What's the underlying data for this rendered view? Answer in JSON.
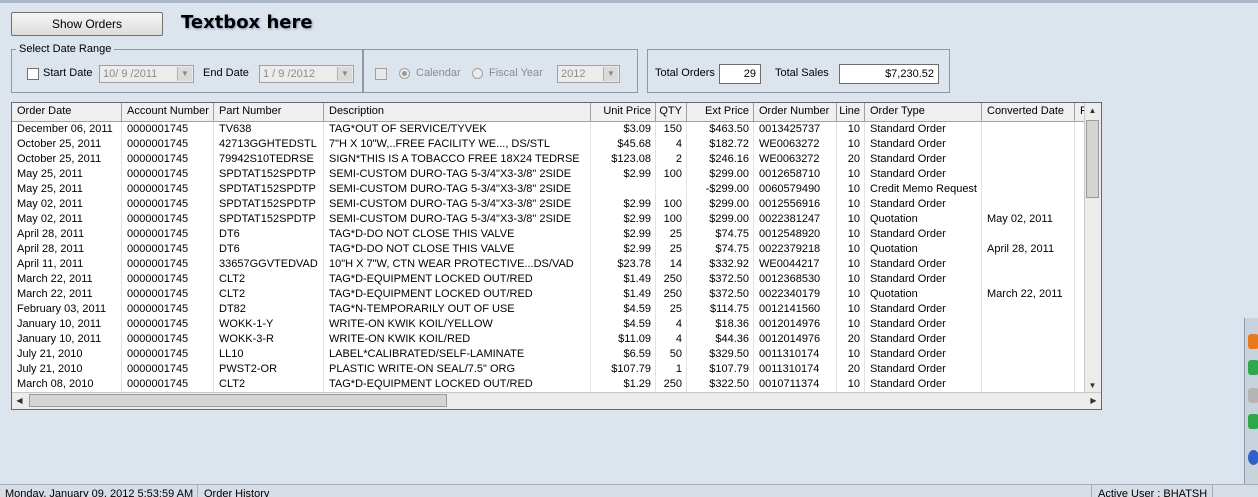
{
  "toolbar": {
    "show_orders_label": "Show Orders",
    "textbox_label": "Textbox here"
  },
  "date_range": {
    "legend": "Select Date Range",
    "start_date_label": "Start Date",
    "start_date_value": "10/ 9 /2011",
    "end_date_label": "End Date",
    "end_date_value": " 1 / 9 /2012",
    "calendar_label": "Calendar",
    "fiscal_year_label": "Fiscal Year",
    "year_value": "2012"
  },
  "totals": {
    "total_orders_label": "Total Orders",
    "total_orders_value": "29",
    "total_sales_label": "Total Sales",
    "total_sales_value": "$7,230.52"
  },
  "grid": {
    "columns": [
      "Order Date",
      "Account Number",
      "Part Number",
      "Description",
      "Unit Price",
      "QTY",
      "Ext Price",
      "Order Number",
      "Line",
      "Order Type",
      "Converted Date",
      "F"
    ],
    "rows": [
      [
        "December 06, 2011",
        "0000001745",
        "TV638",
        "TAG*OUT OF SERVICE/TYVEK",
        "$3.09",
        "150",
        "$463.50",
        "0013425737",
        "10",
        "Standard Order",
        ""
      ],
      [
        "October 25, 2011",
        "0000001745",
        "42713GGHTEDSTL",
        "7\"H X 10\"W,..FREE FACILITY WE..., DS/STL",
        "$45.68",
        "4",
        "$182.72",
        "WE0063272",
        "10",
        "Standard Order",
        ""
      ],
      [
        "October 25, 2011",
        "0000001745",
        "79942S10TEDRSE",
        "SIGN*THIS IS A TOBACCO FREE 18X24 TEDRSE",
        "$123.08",
        "2",
        "$246.16",
        "WE0063272",
        "20",
        "Standard Order",
        ""
      ],
      [
        "May 25, 2011",
        "0000001745",
        "SPDTAT152SPDTP",
        "SEMI-CUSTOM DURO-TAG 5-3/4\"X3-3/8\" 2SIDE",
        "$2.99",
        "100",
        "$299.00",
        "0012658710",
        "10",
        "Standard Order",
        ""
      ],
      [
        "May 25, 2011",
        "0000001745",
        "SPDTAT152SPDTP",
        "SEMI-CUSTOM DURO-TAG 5-3/4\"X3-3/8\" 2SIDE",
        "",
        "",
        "-$299.00",
        "0060579490",
        "10",
        "Credit Memo Request",
        ""
      ],
      [
        "May 02, 2011",
        "0000001745",
        "SPDTAT152SPDTP",
        "SEMI-CUSTOM DURO-TAG 5-3/4\"X3-3/8\" 2SIDE",
        "$2.99",
        "100",
        "$299.00",
        "0012556916",
        "10",
        "Standard Order",
        ""
      ],
      [
        "May 02, 2011",
        "0000001745",
        "SPDTAT152SPDTP",
        "SEMI-CUSTOM DURO-TAG 5-3/4\"X3-3/8\" 2SIDE",
        "$2.99",
        "100",
        "$299.00",
        "0022381247",
        "10",
        "Quotation",
        "May 02, 2011"
      ],
      [
        "April 28, 2011",
        "0000001745",
        "DT6",
        "TAG*D-DO NOT CLOSE THIS VALVE",
        "$2.99",
        "25",
        "$74.75",
        "0012548920",
        "10",
        "Standard Order",
        ""
      ],
      [
        "April 28, 2011",
        "0000001745",
        "DT6",
        "TAG*D-DO NOT CLOSE THIS VALVE",
        "$2.99",
        "25",
        "$74.75",
        "0022379218",
        "10",
        "Quotation",
        "April 28, 2011"
      ],
      [
        "April 11, 2011",
        "0000001745",
        "33657GGVTEDVAD",
        "10\"H X 7\"W, CTN WEAR PROTECTIVE...DS/VAD",
        "$23.78",
        "14",
        "$332.92",
        "WE0044217",
        "10",
        "Standard Order",
        ""
      ],
      [
        "March 22, 2011",
        "0000001745",
        "CLT2",
        "TAG*D-EQUIPMENT LOCKED OUT/RED",
        "$1.49",
        "250",
        "$372.50",
        "0012368530",
        "10",
        "Standard Order",
        ""
      ],
      [
        "March 22, 2011",
        "0000001745",
        "CLT2",
        "TAG*D-EQUIPMENT LOCKED OUT/RED",
        "$1.49",
        "250",
        "$372.50",
        "0022340179",
        "10",
        "Quotation",
        "March 22, 2011"
      ],
      [
        "February 03, 2011",
        "0000001745",
        "DT82",
        "TAG*N-TEMPORARILY OUT OF USE",
        "$4.59",
        "25",
        "$114.75",
        "0012141560",
        "10",
        "Standard Order",
        ""
      ],
      [
        "January 10, 2011",
        "0000001745",
        "WOKK-1-Y",
        "WRITE-ON KWIK KOIL/YELLOW",
        "$4.59",
        "4",
        "$18.36",
        "0012014976",
        "10",
        "Standard Order",
        ""
      ],
      [
        "January 10, 2011",
        "0000001745",
        "WOKK-3-R",
        "WRITE-ON KWIK KOIL/RED",
        "$11.09",
        "4",
        "$44.36",
        "0012014976",
        "20",
        "Standard Order",
        ""
      ],
      [
        "July 21, 2010",
        "0000001745",
        "LL10",
        "LABEL*CALIBRATED/SELF-LAMINATE",
        "$6.59",
        "50",
        "$329.50",
        "0011310174",
        "10",
        "Standard Order",
        ""
      ],
      [
        "July 21, 2010",
        "0000001745",
        "PWST2-OR",
        "PLASTIC WRITE-ON SEAL/7.5\" ORG",
        "$107.79",
        "1",
        "$107.79",
        "0011310174",
        "20",
        "Standard Order",
        ""
      ],
      [
        "March 08, 2010",
        "0000001745",
        "CLT2",
        "TAG*D-EQUIPMENT LOCKED OUT/RED",
        "$1.29",
        "250",
        "$322.50",
        "0010711374",
        "10",
        "Standard Order",
        ""
      ]
    ]
  },
  "status_bar": {
    "datetime": "Monday, January 09, 2012 5:53:59 AM",
    "screen_name": "Order History",
    "active_user": "Active User : BHATSH"
  },
  "icons": {
    "dropdown": "chevron-down-icon",
    "scroll_up": "arrow-up-icon",
    "scroll_down": "arrow-down-icon",
    "scroll_left": "arrow-left-icon",
    "scroll_right": "arrow-right-icon"
  },
  "colors": {
    "background": "#dce4ee",
    "grid_background": "#ffffff",
    "header_background": "#f0f0f0"
  }
}
